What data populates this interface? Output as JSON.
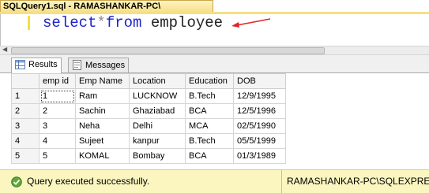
{
  "document_tab": {
    "title": "SQLQuery1.sql - RAMASHANKAR-PC\\"
  },
  "editor": {
    "kw_select": "select",
    "op_star": "*",
    "kw_from": "from",
    "table_name": "employee"
  },
  "results_tabs": [
    {
      "label": "Results",
      "icon": "grid-icon",
      "active": true
    },
    {
      "label": "Messages",
      "icon": "messages-icon",
      "active": false
    }
  ],
  "grid": {
    "columns": [
      "emp id",
      "Emp Name",
      "Location",
      "Education",
      "DOB"
    ],
    "rows": [
      {
        "num": "1",
        "cells": [
          "1",
          "Ram",
          "LUCKNOW",
          "B.Tech",
          "12/9/1995"
        ]
      },
      {
        "num": "2",
        "cells": [
          "2",
          "Sachin",
          "Ghaziabad",
          "BCA",
          "12/5/1996"
        ]
      },
      {
        "num": "3",
        "cells": [
          "3",
          "Neha",
          "Delhi",
          "MCA",
          "02/5/1990"
        ]
      },
      {
        "num": "4",
        "cells": [
          "4",
          "Sujeet",
          "kanpur",
          "B.Tech",
          "05/5/1999"
        ]
      },
      {
        "num": "5",
        "cells": [
          "5",
          "KOMAL",
          "Bombay",
          "BCA",
          "01/3/1989"
        ]
      }
    ]
  },
  "status": {
    "message": "Query executed successfully.",
    "server": "RAMASHANKAR-PC\\SQLEXPRESS",
    "icon": "check-icon"
  },
  "colors": {
    "keyword": "#1f24c9",
    "status_bg": "#fbf6c0",
    "tab_bg": "#f6df82",
    "annotation_arrow": "#e0242b"
  }
}
